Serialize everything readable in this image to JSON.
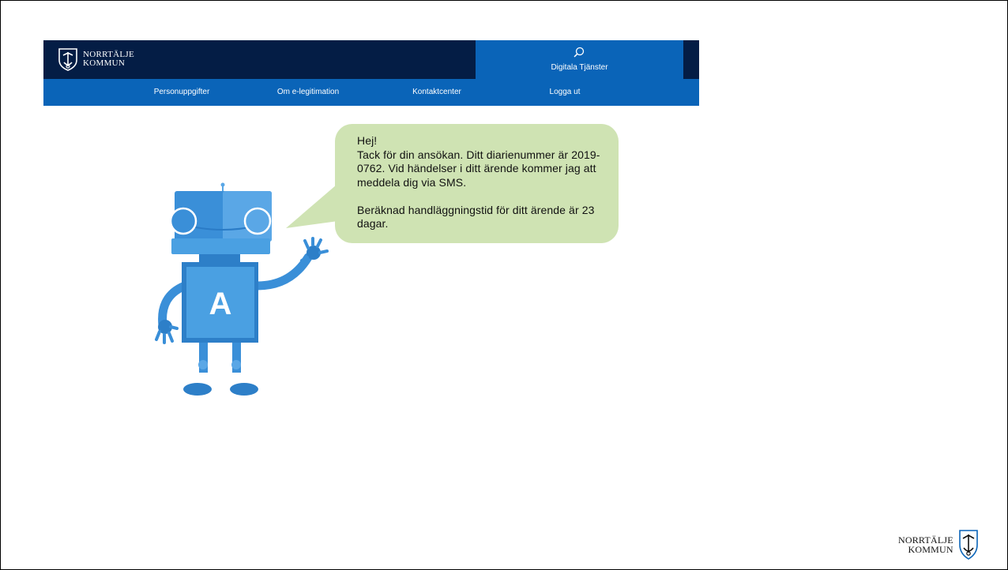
{
  "header": {
    "logo_line1": "NORRTÄLJE",
    "logo_line2": "KOMMUN",
    "services_label": "Digitala Tjänster",
    "services_icon": "search-icon"
  },
  "nav": {
    "items": [
      {
        "label": "Personuppgifter"
      },
      {
        "label": "Om e-legitimation"
      },
      {
        "label": "Kontaktcenter"
      },
      {
        "label": "Logga ut"
      }
    ]
  },
  "bubble": {
    "text": "Hej!\nTack för din ansökan. Ditt diarienummer är 2019-0762. Vid händelser i ditt ärende kommer jag att meddela dig via SMS.\n\nBeräknad handläggningstid för ditt ärende är 23 dagar."
  },
  "robot": {
    "letter": "A"
  },
  "footer": {
    "logo_line1": "NORRTÄLJE",
    "logo_line2": "KOMMUN"
  },
  "colors": {
    "header_dark": "#041d45",
    "nav_blue": "#0a64b8",
    "bubble_green": "#cfe3b3",
    "robot_blue": "#3a8fd8"
  }
}
